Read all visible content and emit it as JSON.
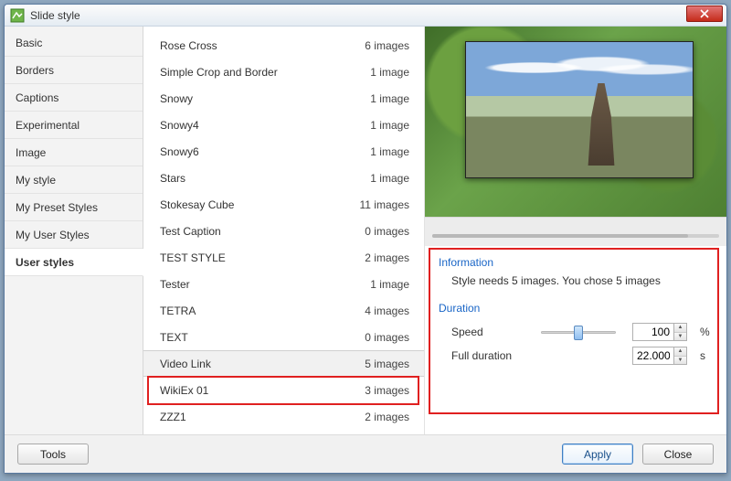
{
  "window": {
    "title": "Slide style"
  },
  "sidebar": {
    "categories": [
      {
        "label": "Basic"
      },
      {
        "label": "Borders"
      },
      {
        "label": "Captions"
      },
      {
        "label": "Experimental"
      },
      {
        "label": "Image"
      },
      {
        "label": "My style"
      },
      {
        "label": "My Preset Styles"
      },
      {
        "label": "My User Styles"
      },
      {
        "label": "User styles"
      }
    ],
    "selected": "User styles"
  },
  "styles": {
    "items": [
      {
        "name": "Rose Cross",
        "count": "6 images"
      },
      {
        "name": "Simple Crop and Border",
        "count": "1 image"
      },
      {
        "name": "Snowy",
        "count": "1 image"
      },
      {
        "name": "Snowy4",
        "count": "1 image"
      },
      {
        "name": "Snowy6",
        "count": "1 image"
      },
      {
        "name": "Stars",
        "count": "1 image"
      },
      {
        "name": "Stokesay Cube",
        "count": "11 images"
      },
      {
        "name": "Test Caption",
        "count": "0 images"
      },
      {
        "name": "TEST STYLE",
        "count": "2 images"
      },
      {
        "name": "Tester",
        "count": "1 image"
      },
      {
        "name": "TETRA",
        "count": "4 images"
      },
      {
        "name": "TEXT",
        "count": "0 images"
      },
      {
        "name": "Video Link",
        "count": "5 images"
      },
      {
        "name": "WikiEx 01",
        "count": "3 images"
      },
      {
        "name": "ZZZ1",
        "count": "2 images"
      }
    ],
    "selected_index": 12
  },
  "info": {
    "heading": "Information",
    "message": "Style needs 5 images. You chose 5 images"
  },
  "duration": {
    "heading": "Duration",
    "speed_label": "Speed",
    "speed_value": "100",
    "speed_unit": "%",
    "full_label": "Full duration",
    "full_value": "22.000",
    "full_unit": "s"
  },
  "footer": {
    "tools": "Tools",
    "apply": "Apply",
    "close": "Close"
  },
  "colors": {
    "highlight": "#e02020",
    "link": "#1a66c7"
  }
}
